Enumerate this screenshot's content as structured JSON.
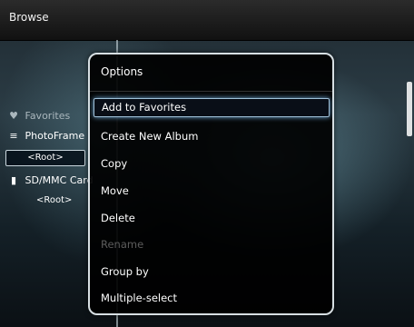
{
  "topbar": {
    "title": "Browse"
  },
  "sidebar": {
    "favorites": "Favorites",
    "photoframe": "PhotoFrame",
    "photoframe_root": "<Root>",
    "sdcard": "SD/MMC Card",
    "sdcard_root": "<Root>"
  },
  "options_menu": {
    "title": "Options",
    "items": [
      {
        "label": "Add to Favorites",
        "selected": true
      },
      {
        "label": "Create New Album"
      },
      {
        "label": "Copy"
      },
      {
        "label": "Move"
      },
      {
        "label": "Delete"
      },
      {
        "label": "Rename",
        "disabled": true
      },
      {
        "label": "Group by"
      },
      {
        "label": "Multiple-select"
      }
    ]
  },
  "icons": {
    "favorites": "heart-icon",
    "photoframe": "list-icon",
    "sdcard": "card-icon"
  }
}
